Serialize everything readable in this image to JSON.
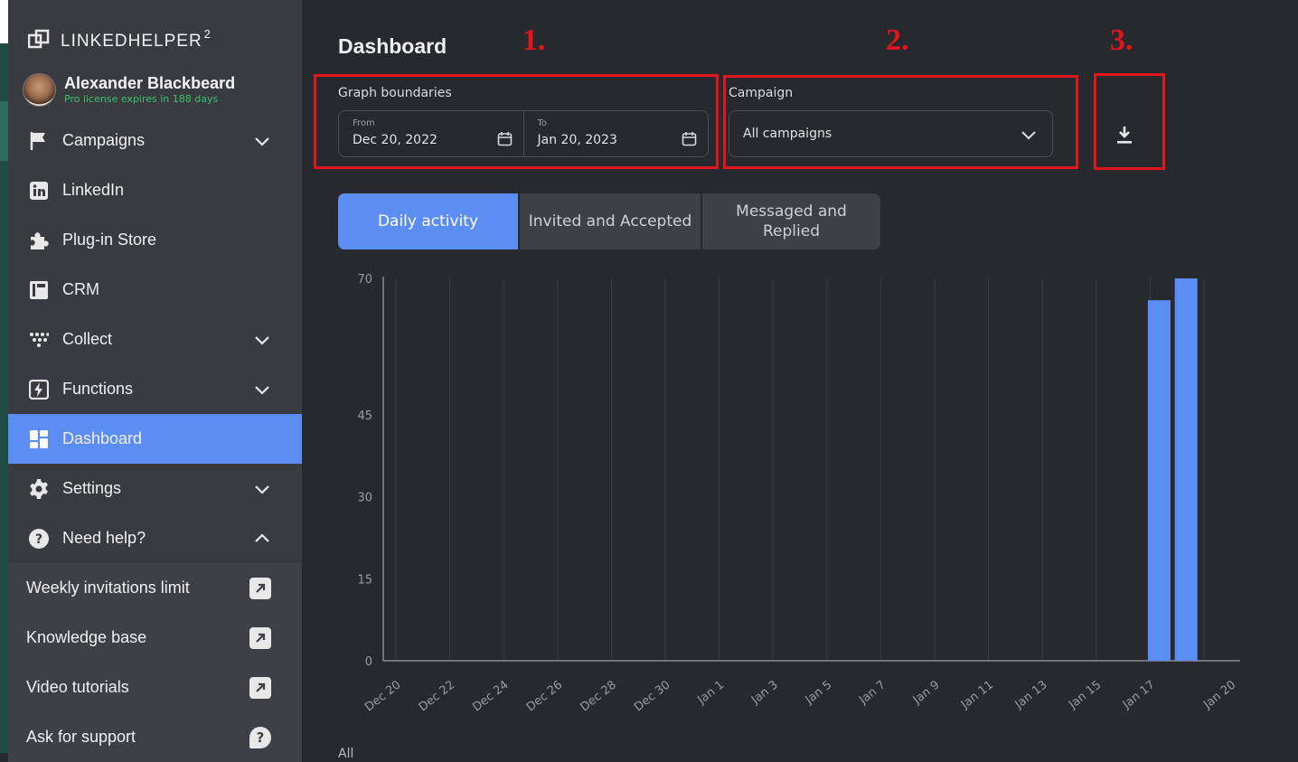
{
  "app": {
    "brand": "LINKEDHELPER",
    "brand_sup": "2"
  },
  "user": {
    "name": "Alexander Blackbeard",
    "license": "Pro license expires in 188 days"
  },
  "nav": [
    {
      "label": "Campaigns",
      "icon": "flag-icon",
      "chevron": "down"
    },
    {
      "label": "LinkedIn",
      "icon": "linkedin-icon"
    },
    {
      "label": "Plug-in Store",
      "icon": "puzzle-icon"
    },
    {
      "label": "CRM",
      "icon": "crm-icon"
    },
    {
      "label": "Collect",
      "icon": "collect-icon",
      "chevron": "down"
    },
    {
      "label": "Functions",
      "icon": "lightning-icon",
      "chevron": "down"
    },
    {
      "label": "Dashboard",
      "icon": "dashboard-icon",
      "active": true
    },
    {
      "label": "Settings",
      "icon": "gear-icon",
      "chevron": "down"
    },
    {
      "label": "Need help?",
      "icon": "help-icon",
      "chevron": "up"
    }
  ],
  "help_items": [
    {
      "label": "Weekly invitations limit",
      "icon": "external-link-icon"
    },
    {
      "label": "Knowledge base",
      "icon": "external-link-icon"
    },
    {
      "label": "Video tutorials",
      "icon": "external-link-icon"
    },
    {
      "label": "Ask for support",
      "icon": "chat-help-icon"
    }
  ],
  "page": {
    "title": "Dashboard"
  },
  "annotations": {
    "one": "1.",
    "two": "2.",
    "three": "3."
  },
  "filters": {
    "graph_label": "Graph boundaries",
    "from_label": "From",
    "from_value": "Dec 20, 2022",
    "to_label": "To",
    "to_value": "Jan 20, 2023",
    "campaign_label": "Campaign",
    "campaign_value": "All campaigns"
  },
  "tabs": [
    {
      "label": "Daily activity",
      "active": true
    },
    {
      "label": "Invited and Accepted"
    },
    {
      "label": "Messaged and Replied"
    }
  ],
  "footer": {
    "text": "All"
  },
  "colors": {
    "accent": "#5b8df2",
    "annotation": "#e0161f",
    "license": "#35c26a",
    "bg": "#27292e",
    "sidebar": "#3a3b40"
  },
  "chart_data": {
    "type": "bar",
    "yticks": [
      0,
      15,
      30,
      45,
      70
    ],
    "ylim": [
      0,
      70
    ],
    "xticks": [
      "Dec 20",
      "Dec 22",
      "Dec 24",
      "Dec 26",
      "Dec 28",
      "Dec 30",
      "Jan 1",
      "Jan 3",
      "Jan 5",
      "Jan 7",
      "Jan 9",
      "Jan 11",
      "Jan 13",
      "Jan 15",
      "Jan 17",
      "Jan 20"
    ],
    "bars": [
      {
        "x": "Jan 17",
        "value": 66
      },
      {
        "x": "Jan 18",
        "value": 70
      }
    ],
    "grid": true
  }
}
